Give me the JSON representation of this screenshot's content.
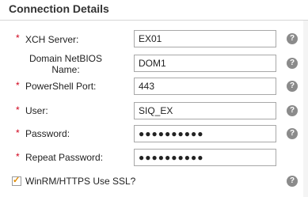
{
  "section": {
    "title": "Connection Details"
  },
  "fields": [
    {
      "label": "XCH Server:",
      "value": "EX01",
      "required": true
    },
    {
      "label_line1": "Domain NetBIOS",
      "label_line2": "Name:",
      "value": "DOM1",
      "required": false
    },
    {
      "label": "PowerShell Port:",
      "value": "443",
      "required": true
    },
    {
      "label": "User:",
      "value": "SIQ_EX",
      "required": true
    },
    {
      "label": "Password:",
      "value": "●●●●●●●●●●",
      "required": true
    },
    {
      "label": "Repeat Password:",
      "value": "●●●●●●●●●●",
      "required": true
    }
  ],
  "required_marker": "*",
  "help_glyph": "?",
  "ssl_checkbox": {
    "label": "WinRM/HTTPS Use SSL?",
    "checked": true,
    "check_glyph": "✓"
  },
  "colors": {
    "required": "#d0021b",
    "help_icon": "#8b8b8b",
    "check": "#e08a00"
  }
}
